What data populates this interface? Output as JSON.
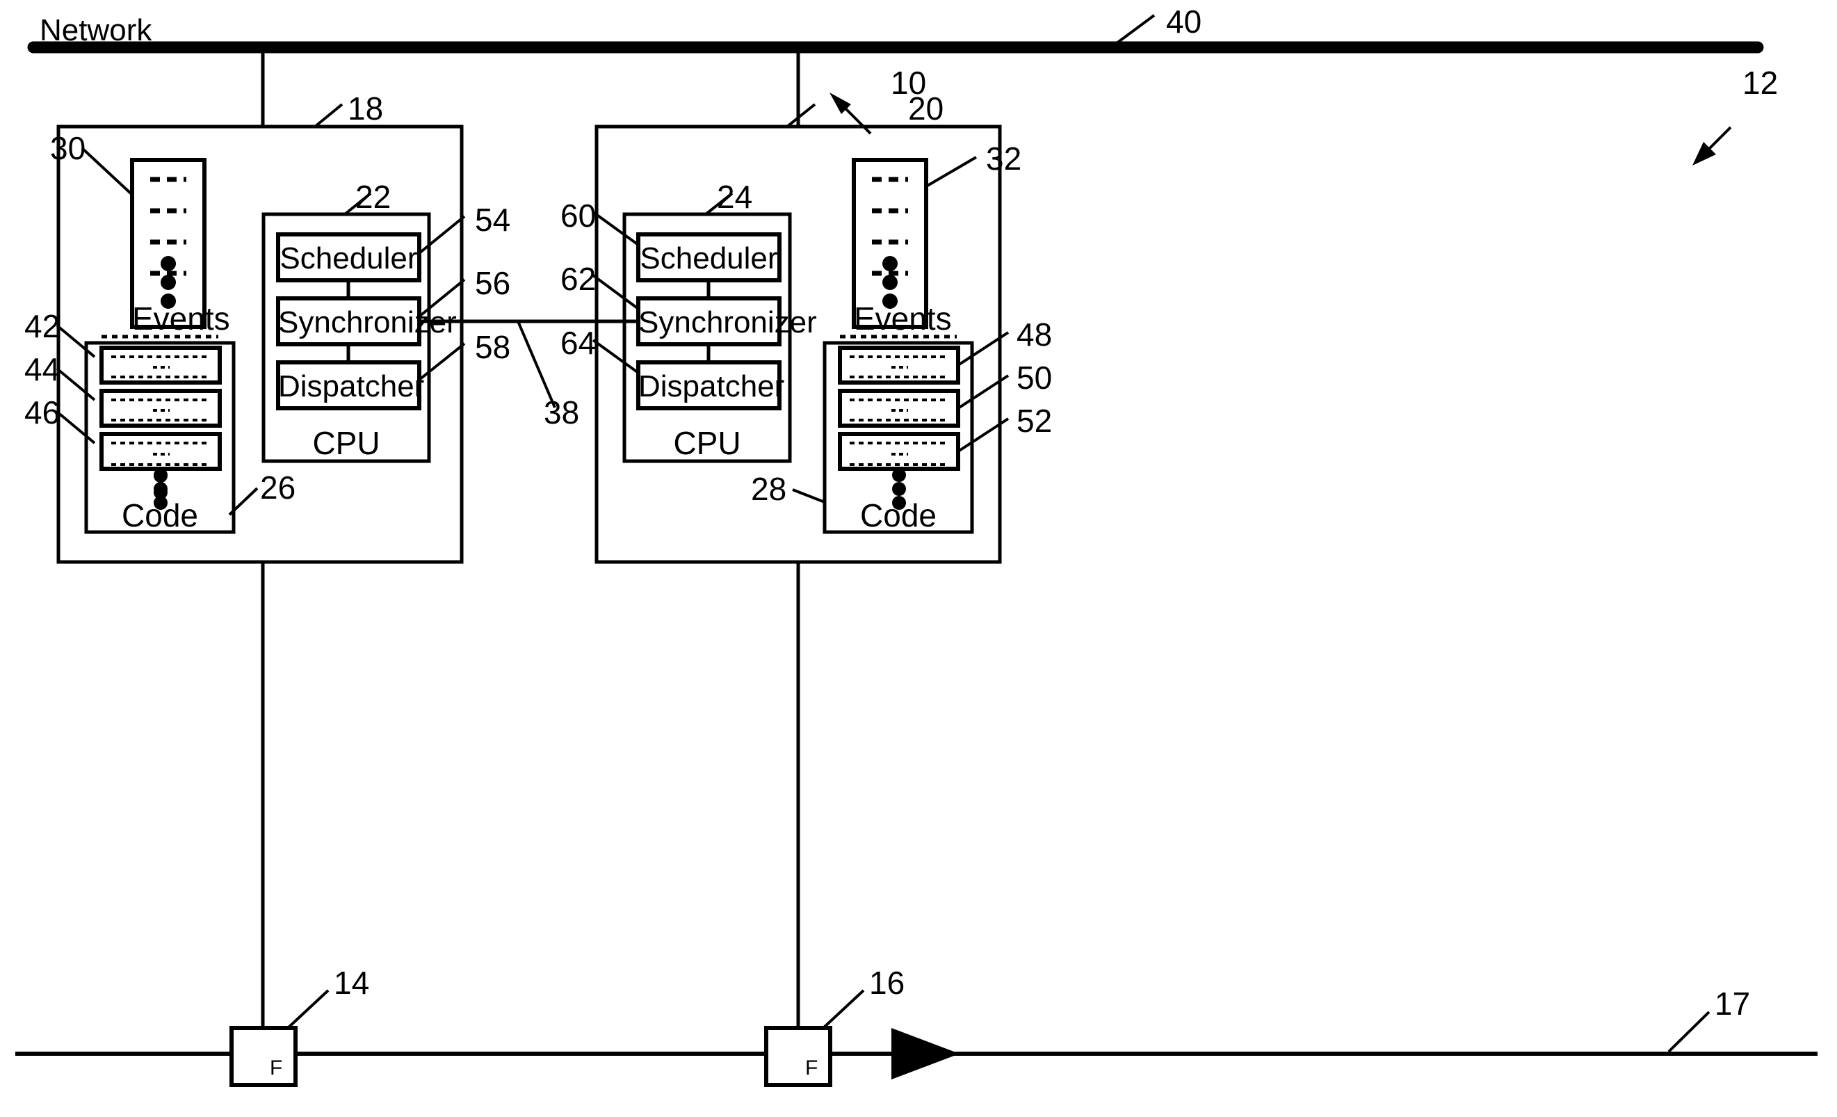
{
  "figure": {
    "title_label": "Network",
    "network_bus_ref": "40",
    "left_system_ref": "10",
    "right_system_ref": "12",
    "fieldbus_ref": "17"
  },
  "left_node": {
    "container_ref": "18",
    "events": {
      "label": "Events",
      "ref": "30",
      "dashed_line_count": 4,
      "dot_count": 3
    },
    "code": {
      "label": "Code",
      "ref": "26",
      "block_refs": [
        "42",
        "44",
        "46"
      ],
      "block_count": 3,
      "dot_count": 3
    },
    "cpu": {
      "label": "CPU",
      "ref": "22",
      "units": [
        {
          "label": "Scheduler",
          "ref": "54"
        },
        {
          "label": "Synchronizer",
          "ref": "56"
        },
        {
          "label": "Dispatcher",
          "ref": "58"
        }
      ]
    },
    "field_device": {
      "letter": "F",
      "ref": "14"
    }
  },
  "right_node": {
    "container_ref": "20",
    "events": {
      "label": "Events",
      "ref": "32",
      "dashed_line_count": 4,
      "dot_count": 3
    },
    "code": {
      "label": "Code",
      "ref": "28",
      "block_refs": [
        "48",
        "50",
        "52"
      ],
      "block_count": 3,
      "dot_count": 3
    },
    "cpu": {
      "label": "CPU",
      "ref": "24",
      "units": [
        {
          "label": "Scheduler",
          "ref": "60"
        },
        {
          "label": "Synchronizer",
          "ref": "62"
        },
        {
          "label": "Dispatcher",
          "ref": "64"
        }
      ]
    },
    "field_device": {
      "letter": "F",
      "ref": "16"
    }
  },
  "link": {
    "synchronizer_link_ref": "38"
  },
  "colors": {
    "ink": "#000000",
    "paper": "#ffffff"
  }
}
